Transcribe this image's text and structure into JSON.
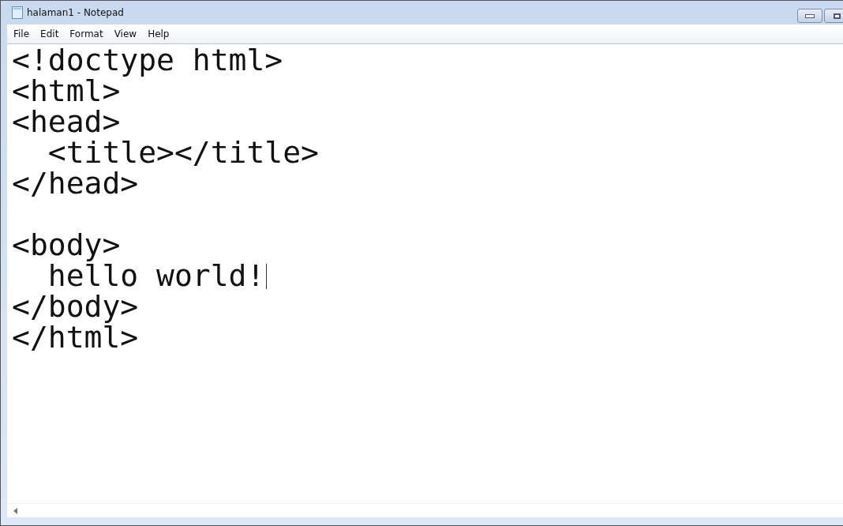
{
  "window": {
    "title": "halaman1 - Notepad"
  },
  "menu": [
    "File",
    "Edit",
    "Format",
    "View",
    "Help"
  ],
  "editor": {
    "lines": [
      {
        "kind": "code",
        "text": "<!doctype html>",
        "caret": false
      },
      {
        "kind": "code",
        "text": "<html>",
        "caret": false
      },
      {
        "kind": "code",
        "text": "<head>",
        "caret": false
      },
      {
        "kind": "code",
        "text": "  <title></title>",
        "caret": false
      },
      {
        "kind": "code",
        "text": "</head>",
        "caret": false
      },
      {
        "kind": "blank"
      },
      {
        "kind": "code",
        "text": "<body>",
        "caret": false
      },
      {
        "kind": "code",
        "text": "  hello world!",
        "caret": true
      },
      {
        "kind": "code",
        "text": "</body>",
        "caret": false
      },
      {
        "kind": "code",
        "text": "</html>",
        "caret": false
      }
    ]
  }
}
